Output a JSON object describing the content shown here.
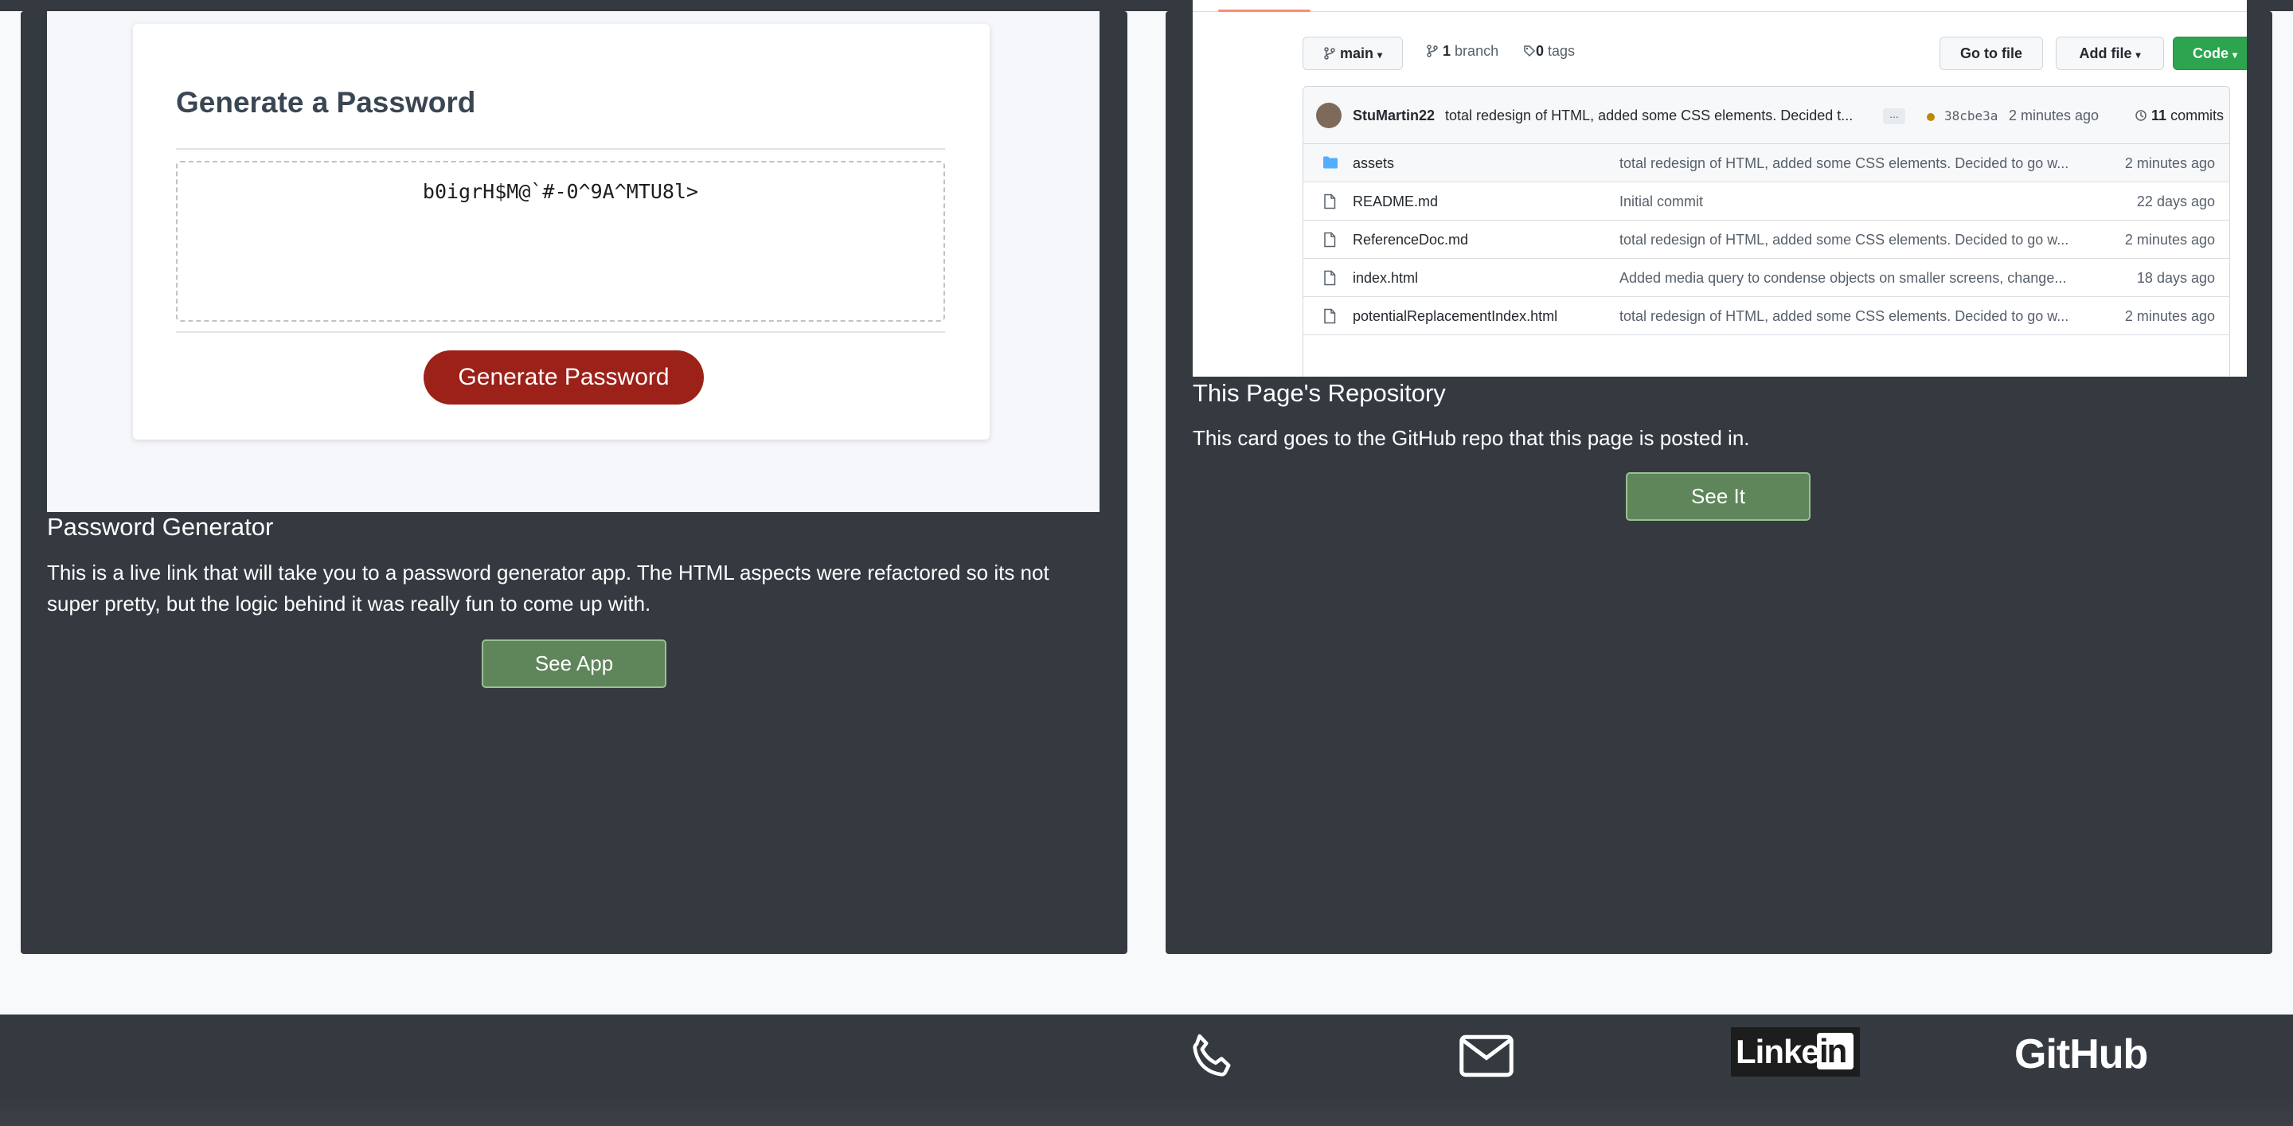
{
  "cards": [
    {
      "title": "Password Generator",
      "text": "This is a live link that will take you to a password generator app. The HTML aspects were refactored so its not super pretty, but the logic behind it was really fun to come up with.",
      "button": "See App",
      "preview": {
        "heading": "Generate a Password",
        "password": "b0igrH$M@`#-0^9A^MTU8l>",
        "button": "Generate Password"
      }
    },
    {
      "title": "This Page's Repository",
      "text": "This card goes to the GitHub repo that this page is posted in.",
      "button": "See It",
      "preview": {
        "branch": "main",
        "branches_count": "1",
        "branches_label": "branch",
        "tags_count": "0",
        "tags_label": "tags",
        "go_to_file": "Go to file",
        "add_file": "Add file",
        "code": "Code",
        "commit": {
          "author": "StuMartin22",
          "message": "total redesign of HTML, added some CSS elements. Decided t...",
          "ellipsis": "...",
          "hash": "38cbe3a",
          "when": "2 minutes ago",
          "commits_count": "11",
          "commits_label": "commits"
        },
        "files": [
          {
            "name": "assets",
            "type": "folder",
            "message": "total redesign of HTML, added some CSS elements. Decided to go w...",
            "age": "2 minutes ago"
          },
          {
            "name": "README.md",
            "type": "file",
            "message": "Initial commit",
            "age": "22 days ago"
          },
          {
            "name": "ReferenceDoc.md",
            "type": "file",
            "message": "total redesign of HTML, added some CSS elements. Decided to go w...",
            "age": "2 minutes ago"
          },
          {
            "name": "index.html",
            "type": "file",
            "message": "Added media query to condense objects on smaller screens, change...",
            "age": "18 days ago"
          },
          {
            "name": "potentialReplacementIndex.html",
            "type": "file",
            "message": "total redesign of HTML, added some CSS elements. Decided to go w...",
            "age": "2 minutes ago"
          }
        ]
      }
    }
  ],
  "footer": {
    "icons": [
      "phone-icon",
      "mail-icon",
      "linkedin-logo",
      "github-logo"
    ],
    "linkedin_text": "Linked",
    "linkedin_in": "in",
    "github_text": "GitHub"
  },
  "colors": {
    "background": "#f8f9fa",
    "card": "#343a40",
    "button": "#5f855a",
    "generate_button": "#9b2119",
    "code_button": "#2da44e"
  }
}
